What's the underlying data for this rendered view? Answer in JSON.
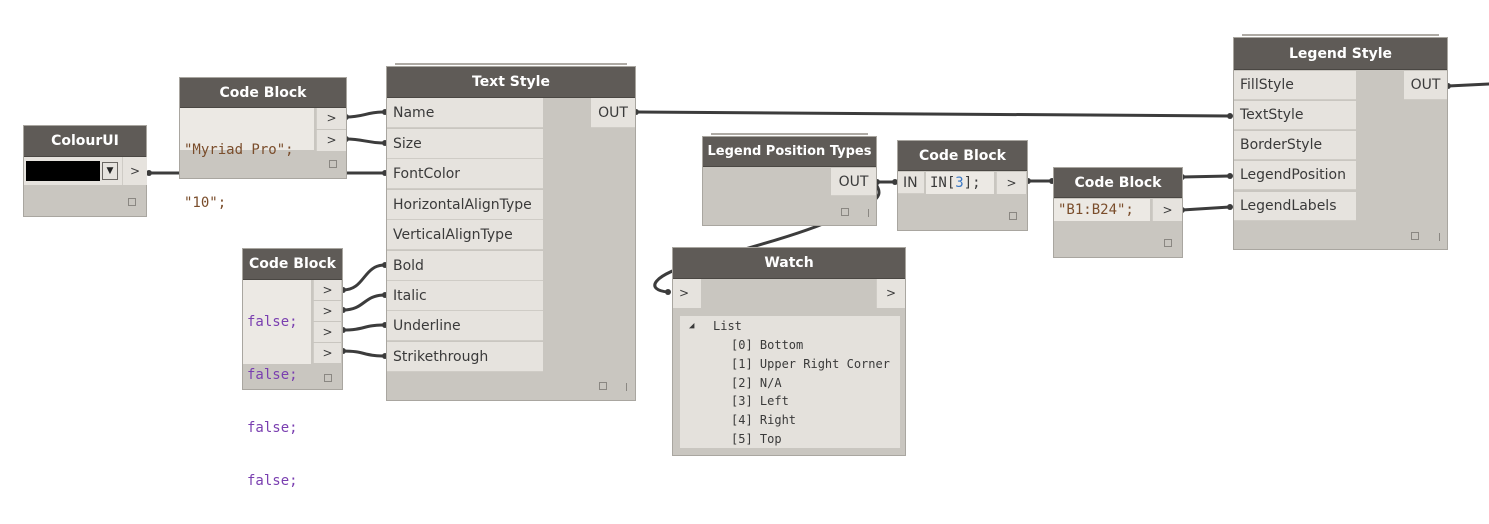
{
  "colour_ui": {
    "title": "ColourUI",
    "color": "#000000",
    "arrow": ">"
  },
  "code_block_font": {
    "title": "Code Block",
    "lines": [
      "\"Myriad Pro\";",
      "\"10\";"
    ],
    "arrows": [
      ">",
      ">"
    ]
  },
  "text_style": {
    "title": "Text Style",
    "inputs": [
      "Name",
      "Size",
      "FontColor",
      "HorizontalAlignType",
      "VerticalAlignType",
      "Bold",
      "Italic",
      "Underline",
      "Strikethrough"
    ],
    "output": "OUT"
  },
  "code_block_bools": {
    "title": "Code Block",
    "lines": [
      "false;",
      "false;",
      "false;",
      "false;"
    ],
    "arrows": [
      ">",
      ">",
      ">",
      ">"
    ]
  },
  "legend_position_types": {
    "title": "Legend Position Types",
    "output": "OUT"
  },
  "code_block_index": {
    "title": "Code Block",
    "input": "IN",
    "code_prefix": "IN[",
    "code_index": "3",
    "code_suffix": "];",
    "arrow": ">"
  },
  "code_block_range": {
    "title": "Code Block",
    "code": "\"B1:B24\";",
    "arrow": ">"
  },
  "legend_style": {
    "title": "Legend Style",
    "inputs": [
      "FillStyle",
      "TextStyle",
      "BorderStyle",
      "LegendPosition",
      "LegendLabels"
    ],
    "output": "OUT"
  },
  "watch": {
    "title": "Watch",
    "input_arrow": ">",
    "output_arrow": ">",
    "list_label": "List",
    "items": [
      "[0] Bottom",
      "[1] Upper Right Corner",
      "[2] N/A",
      "[3] Left",
      "[4] Right",
      "[5] Top"
    ]
  }
}
